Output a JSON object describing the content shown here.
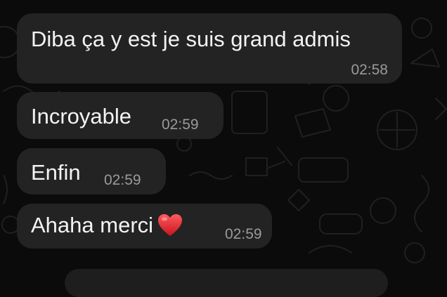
{
  "chat": {
    "messages": [
      {
        "text": "Diba ça y est je suis grand admis",
        "time": "02:58"
      },
      {
        "text": "Incroyable",
        "time": "02:59"
      },
      {
        "text": "Enfin",
        "time": "02:59"
      },
      {
        "text": "Ahaha merci",
        "emoji": "red-heart-icon",
        "time": "02:59"
      }
    ]
  },
  "colors": {
    "background": "#0b0b0b",
    "bubble": "#232323",
    "text": "#f3f3f3",
    "timestamp": "#9a9a9a",
    "heart": "#e0282e"
  }
}
